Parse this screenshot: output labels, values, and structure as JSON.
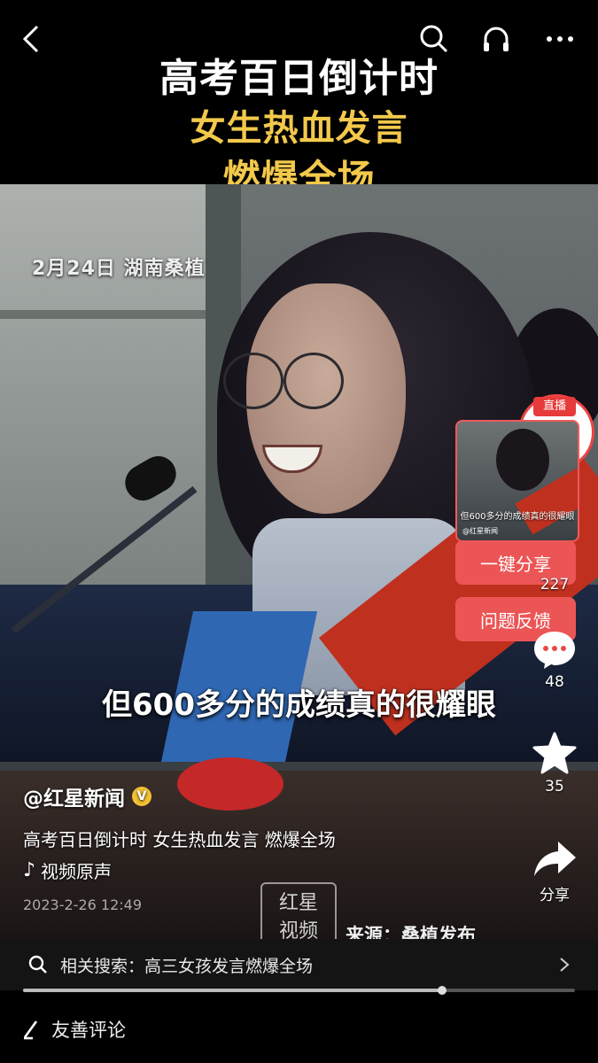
{
  "header": {
    "back_icon": "chevron-left-icon",
    "search_icon": "search-icon",
    "listen_icon": "headphones-icon",
    "more_icon": "more-horizontal-icon"
  },
  "headline": {
    "line1": "高考百日倒计时",
    "line2": "女生热血发言",
    "line3": "燃爆全场"
  },
  "video": {
    "date_location": "2月24日 湖南桑植",
    "subtitle": "但600多分的成绩真的很耀眼",
    "watermark": "红星\n视频",
    "source": "来源：桑植发布"
  },
  "share_popup": {
    "live_label": "直播",
    "thumb_caption": "但600多分的成绩真的很耀眼",
    "thumb_author": "@红星新闻",
    "share_label": "一键分享",
    "feedback_label": "问题反馈"
  },
  "rail": {
    "like_count": "227",
    "comment_count": "48",
    "favorite_count": "35",
    "share_label": "分享"
  },
  "info": {
    "author": "@红星新闻",
    "description": "高考百日倒计时 女生热血发言 燃爆全场",
    "music": "视频原声",
    "timestamp": "2023-2-26 12:49"
  },
  "related_search": {
    "text": "相关搜索：高三女孩发言燃爆全场"
  },
  "progress": {
    "fraction": 0.76
  },
  "comment": {
    "placeholder": "友善评论"
  },
  "colors": {
    "accent_red": "#ec5555",
    "headline_yellow": "#f3c94c",
    "verified_yellow": "#f3c134"
  }
}
